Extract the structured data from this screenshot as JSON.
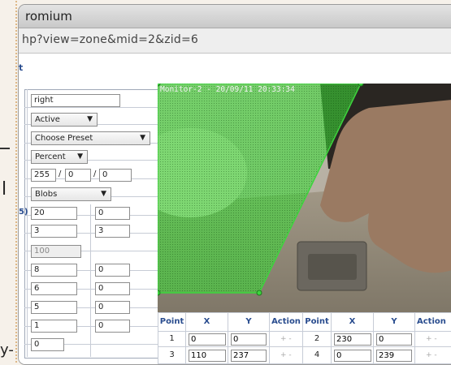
{
  "window": {
    "title": "romium"
  },
  "address_bar": {
    "url": "hp?view=zone&mid=2&zid=6"
  },
  "page": {
    "title_fragment": "t"
  },
  "clipped_left": {
    "line1": "-",
    "line2": "l",
    "line3": "y-"
  },
  "form": {
    "name_value": "right",
    "state_select": "Active",
    "preset_select": "Choose Preset",
    "units_select": "Percent",
    "alarm_rgb": [
      "255",
      "0",
      "0"
    ],
    "check_method_select": "Blobs",
    "row_label_fragment": "5)",
    "min_max_pairs": [
      [
        "20",
        "0"
      ],
      [
        "3",
        "3"
      ]
    ],
    "disabled_value": "100",
    "more_pairs": [
      [
        "8",
        "0"
      ],
      [
        "6",
        "0"
      ],
      [
        "5",
        "0"
      ],
      [
        "1",
        "0"
      ]
    ],
    "last_value": "0"
  },
  "camera": {
    "overlay_text": "Monitor-2 - 20/09/11 20:33:34"
  },
  "points_table": {
    "headers": [
      "Point",
      "X",
      "Y",
      "Action",
      "Point",
      "X",
      "Y",
      "Action"
    ],
    "rows": [
      {
        "p1": "1",
        "x1": "0",
        "y1": "0",
        "a1": "+ -",
        "p2": "2",
        "x2": "230",
        "y2": "0",
        "a2": "+ -"
      },
      {
        "p1": "3",
        "x1": "110",
        "y1": "237",
        "a1": "+ -",
        "p2": "4",
        "x2": "0",
        "y2": "239",
        "a2": "+ -"
      }
    ]
  },
  "colors": {
    "zone_green": "#3dd43d",
    "header_blue": "#2a4d8f"
  }
}
